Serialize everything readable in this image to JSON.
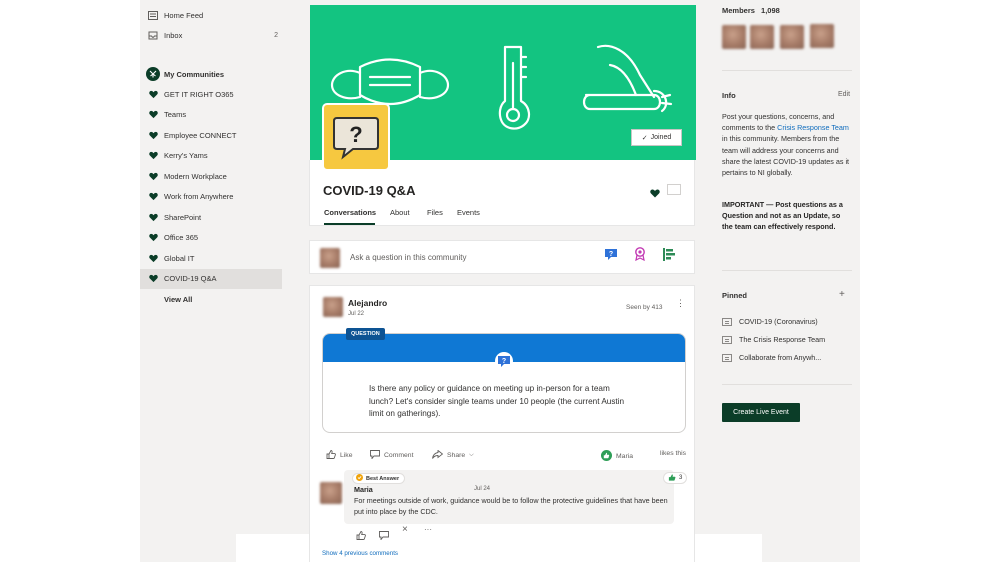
{
  "left_nav": {
    "home_feed": "Home Feed",
    "inbox": "Inbox",
    "inbox_count": "2",
    "my_communities": "My Communities",
    "communities": [
      "GET IT RIGHT O365",
      "Teams",
      "Employee CONNECT",
      "Kerry's Yams",
      "Modern Workplace",
      "Work from Anywhere",
      "SharePoint",
      "Office 365",
      "Global IT",
      "COVID-19 Q&A"
    ],
    "view_all": "View All"
  },
  "community": {
    "name": "COVID-19 Q&A",
    "joined_label": "Joined",
    "tabs": [
      "Conversations",
      "About",
      "Files",
      "Events"
    ],
    "accent": "#13c481"
  },
  "ask": {
    "placeholder": "Ask a question in this community"
  },
  "post": {
    "author": "Alejandro",
    "date": "Jul 22",
    "seen_by": "Seen by 413",
    "tag": "QUESTION",
    "text": "Is there any policy or guidance on meeting up in-person for a team lunch? Let's consider single teams under 10 people (the current Austin limit on gatherings).",
    "like": "Like",
    "comment": "Comment",
    "share": "Share",
    "liker": "Maria",
    "likes_this": "likes this",
    "reply": {
      "badge": "Best Answer",
      "author": "Maria",
      "date": "Jul 24",
      "text": "For meetings outside of work, guidance would be to follow the protective guidelines that have been put into place by the CDC.",
      "like_count": "3"
    },
    "show_previous": "Show 4 previous comments"
  },
  "right_panel": {
    "members_label": "Members",
    "members_count": "1,098",
    "info_title": "Info",
    "edit": "Edit",
    "info_text_1": "Post your questions, concerns, and comments to the ",
    "info_link": "Crisis Response Team",
    "info_text_2": " in this community. Members from the team will address your concerns and share the latest COVID-19 updates as it pertains to NI globally.",
    "important": "IMPORTANT — Post questions as a Question and not as an Update, so the team can effectively respond.",
    "pinned_title": "Pinned",
    "pinned": [
      "COVID-19 (Coronavirus)",
      "The Crisis Response Team",
      "Collaborate from Anywh..."
    ],
    "live_event": "Create Live Event"
  }
}
